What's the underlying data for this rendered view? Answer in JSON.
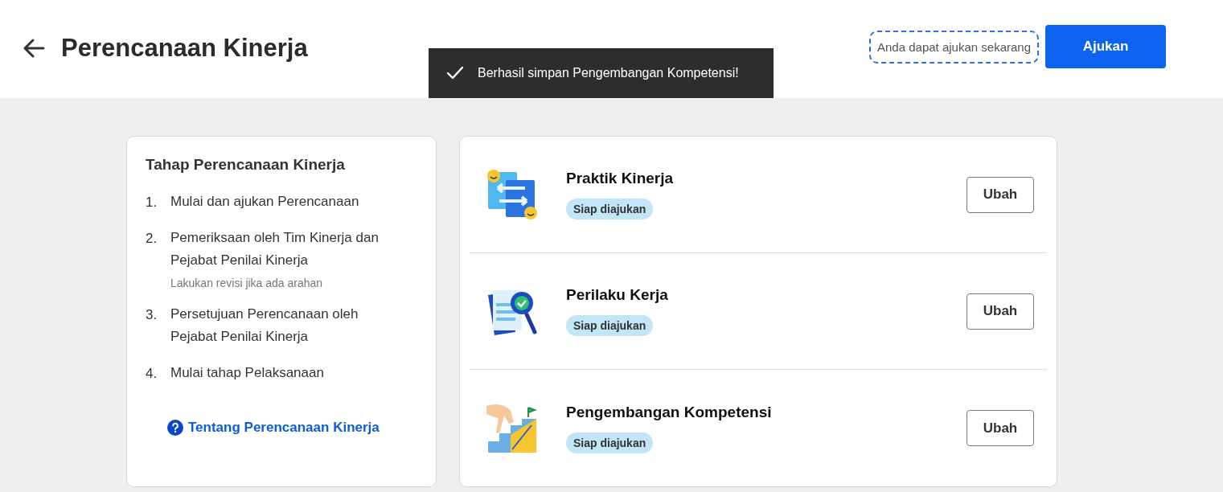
{
  "header": {
    "title": "Perencanaan Kinerja",
    "hint": "Anda dapat ajukan sekarang",
    "submit_button": "Ajukan"
  },
  "toast": {
    "message": "Berhasil simpan Pengembangan Kompetensi!"
  },
  "steps_card": {
    "title": "Tahap Perencanaan Kinerja",
    "steps": [
      {
        "number": "1.",
        "text": "Mulai dan ajukan Perencanaan"
      },
      {
        "number": "2.",
        "text": "Pemeriksaan oleh Tim Kinerja dan Pejabat Penilai Kinerja",
        "note": "Lakukan revisi jika ada arahan"
      },
      {
        "number": "3.",
        "text": "Persetujuan Perencanaan oleh Pejabat Penilai Kinerja"
      },
      {
        "number": "4.",
        "text": "Mulai tahap Pelaksanaan"
      }
    ],
    "help_link": "Tentang Perencanaan Kinerja"
  },
  "sections": [
    {
      "kind": "swap",
      "title": "Praktik Kinerja",
      "status": "Siap diajukan",
      "button": "Ubah"
    },
    {
      "kind": "review",
      "title": "Perilaku Kerja",
      "status": "Siap diajukan",
      "button": "Ubah"
    },
    {
      "kind": "stairs",
      "title": "Pengembangan Kompetensi",
      "status": "Siap diajukan",
      "button": "Ubah"
    }
  ]
}
